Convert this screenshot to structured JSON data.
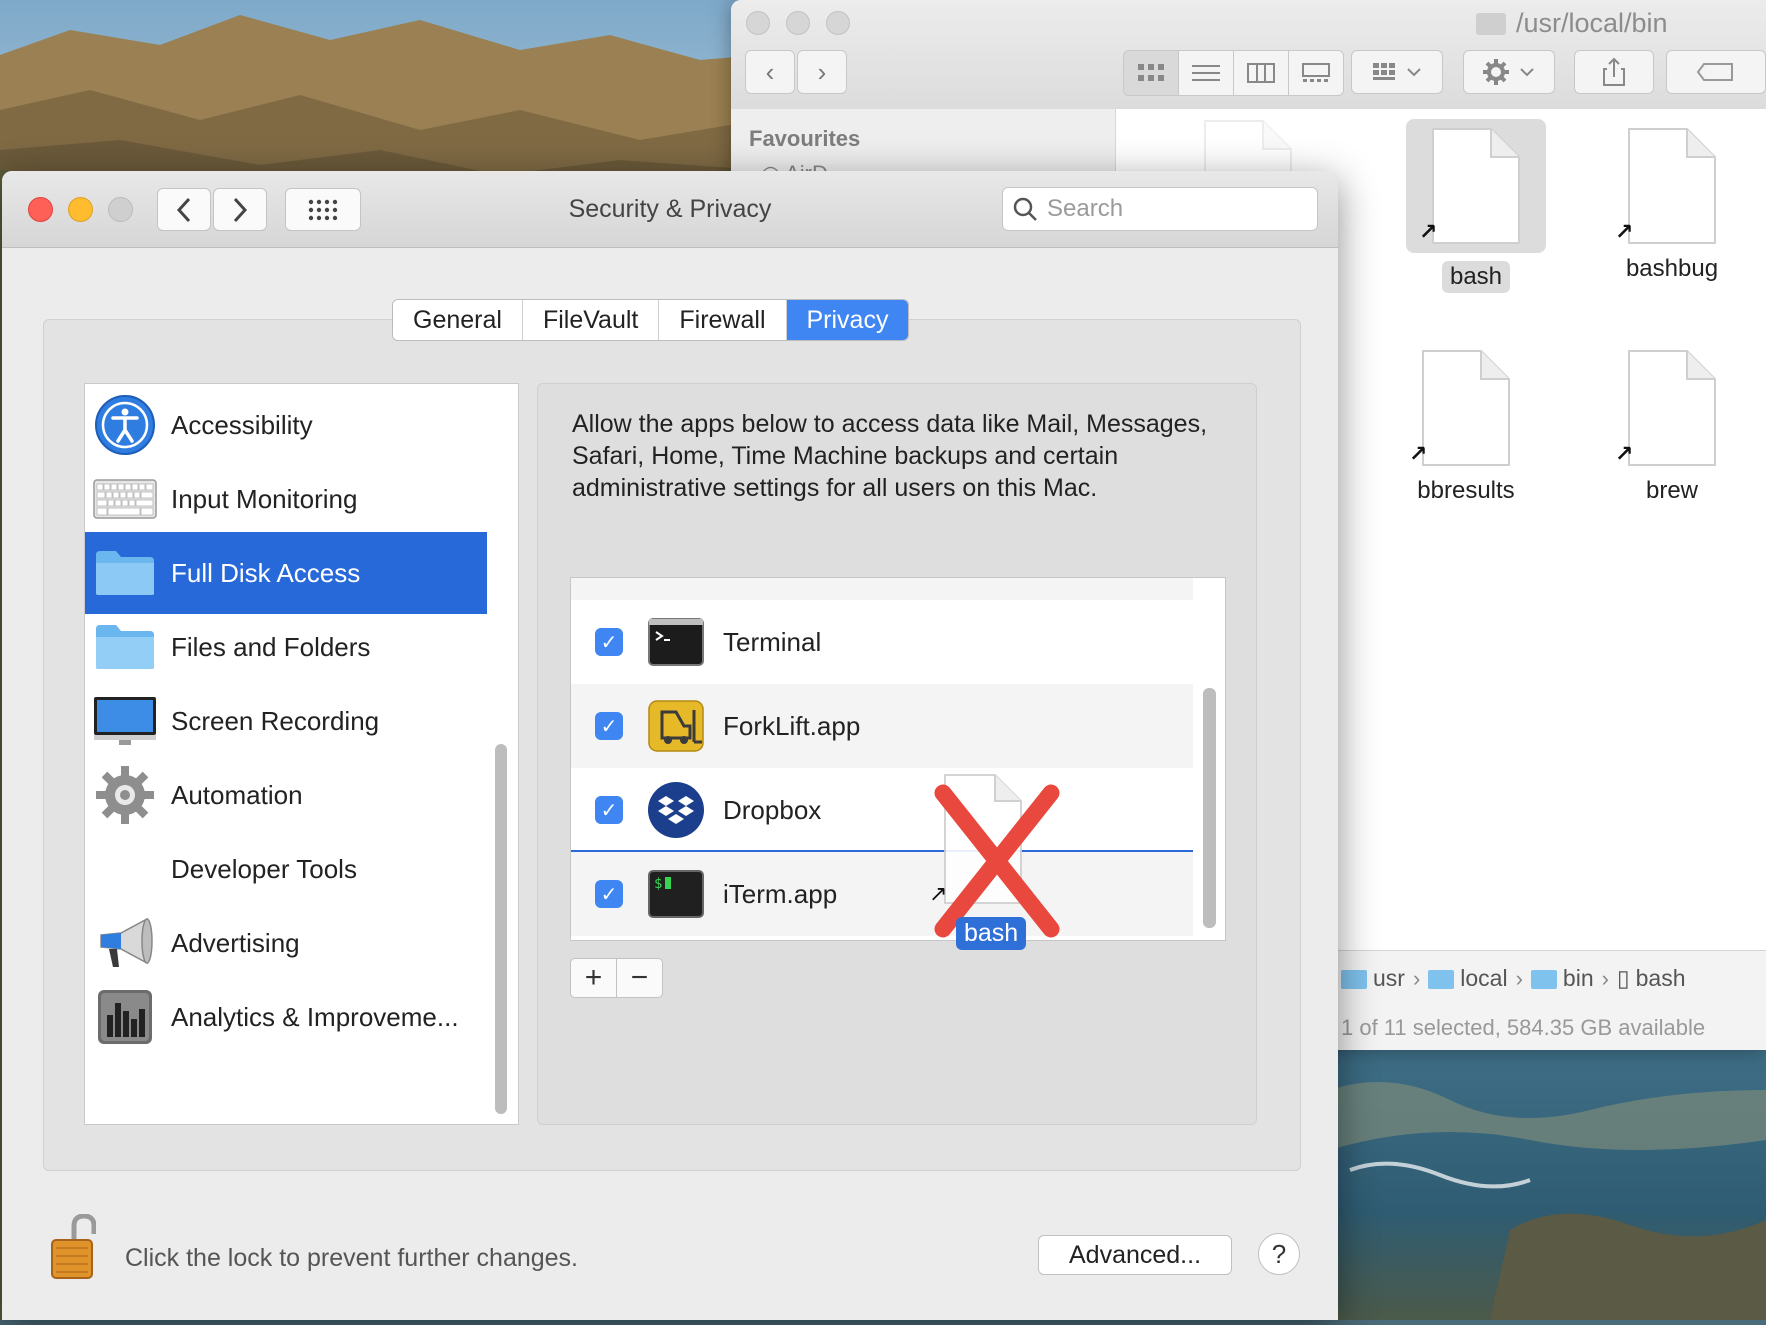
{
  "finder": {
    "path_title": "/usr/local/bin",
    "sidebar_header": "Favourites",
    "sidebar_partial_item": "AirD",
    "files": [
      {
        "name": "bash",
        "selected": true
      },
      {
        "name": "bashbug",
        "selected": false
      },
      {
        "name": "bbresults",
        "selected": false
      },
      {
        "name": "brew",
        "selected": false
      }
    ],
    "path_bar": [
      "usr",
      "local",
      "bin",
      "bash"
    ],
    "status": "1 of 11 selected, 584.35 GB available"
  },
  "security_privacy": {
    "title": "Security & Privacy",
    "search_placeholder": "Search",
    "tabs": [
      {
        "label": "General",
        "active": false
      },
      {
        "label": "FileVault",
        "active": false
      },
      {
        "label": "Firewall",
        "active": false
      },
      {
        "label": "Privacy",
        "active": true
      }
    ],
    "categories": [
      {
        "label": "Accessibility",
        "icon": "accessibility-icon"
      },
      {
        "label": "Input Monitoring",
        "icon": "keyboard-icon"
      },
      {
        "label": "Full Disk Access",
        "icon": "folder-icon",
        "selected": true
      },
      {
        "label": "Files and Folders",
        "icon": "folder-icon"
      },
      {
        "label": "Screen Recording",
        "icon": "display-icon"
      },
      {
        "label": "Automation",
        "icon": "gear-icon"
      },
      {
        "label": "Developer Tools",
        "icon": ""
      },
      {
        "label": "Advertising",
        "icon": "megaphone-icon"
      },
      {
        "label": "Analytics & Improveme...",
        "icon": "chart-icon"
      }
    ],
    "description": "Allow the apps below to access data like Mail, Messages, Safari, Home, Time Machine backups and certain administrative settings for all users on this Mac.",
    "apps": [
      {
        "name": "Terminal",
        "checked": true,
        "icon": "terminal-icon"
      },
      {
        "name": "ForkLift.app",
        "checked": true,
        "icon": "forklift-icon"
      },
      {
        "name": "Dropbox",
        "checked": true,
        "icon": "dropbox-icon"
      },
      {
        "name": "iTerm.app",
        "checked": true,
        "icon": "iterm-icon"
      }
    ],
    "add_label": "+",
    "remove_label": "−",
    "lock_text": "Click the lock to prevent further changes.",
    "advanced_label": "Advanced...",
    "help_label": "?"
  },
  "drag_ghost": {
    "label": "bash",
    "status_icon": "not-allowed-x-icon",
    "x_color": "#e8483e"
  },
  "colors": {
    "selection_blue": "#2869d9",
    "tab_active": "#3f86f3",
    "checkbox": "#3f86f3"
  }
}
